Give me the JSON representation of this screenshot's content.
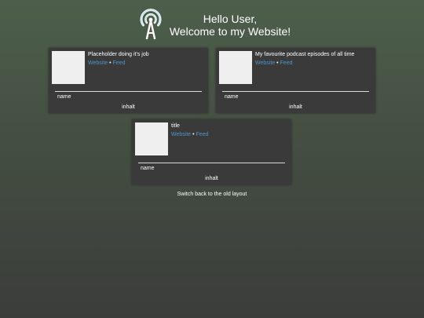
{
  "header": {
    "logo_icon": "podcast-antenna-icon",
    "greeting_line1": "Hello User,",
    "greeting_line2": "Welcome to my Website!"
  },
  "cards": [
    {
      "title": "Placeholder doing it's job",
      "website_label": "Website",
      "separator": "•",
      "feed_label": "Feed",
      "name": "name",
      "content": "inhalt"
    },
    {
      "title": "My favourite podcast episodes of all time",
      "website_label": "Website",
      "separator": "•",
      "feed_label": "Feed",
      "name": "name",
      "content": "inhalt"
    },
    {
      "title": "title",
      "website_label": "Website",
      "separator": "•",
      "feed_label": "Feed",
      "name": "name",
      "content": "inhalt"
    }
  ],
  "footer": {
    "switch_label": "Switch back to the old layout"
  },
  "colors": {
    "card_background": "#3a3a3a",
    "link": "#4f94c9",
    "thumbnail": "#efefef"
  }
}
